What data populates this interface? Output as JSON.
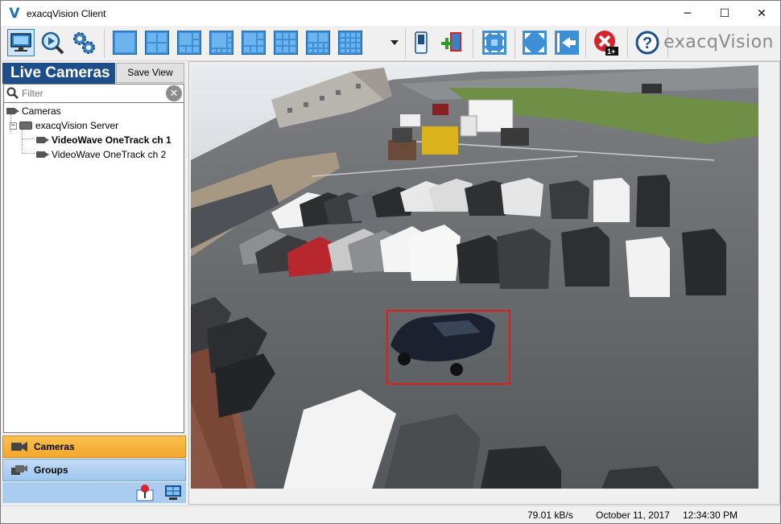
{
  "window": {
    "title": "exacqVision Client",
    "app_logo": "V",
    "controls": {
      "minimize": "─",
      "maximize": "☐",
      "close": "✕"
    }
  },
  "toolbar": {
    "brand": "exacqVision",
    "buttons": [
      "live-view-icon",
      "search-playback-icon",
      "config-gears-icon",
      "layout-1x1-icon",
      "layout-2x2-icon",
      "layout-1plus5-icon",
      "layout-1plus7-icon",
      "layout-3x3-icon",
      "layout-4x3-icon",
      "layout-4x4-icon",
      "layout-5x4-icon",
      "layout-dropdown-icon",
      "switch-icon",
      "add-view-icon",
      "fullscreen-grid-icon",
      "expand-icon",
      "sidebar-toggle-icon",
      "alarm-clear-icon",
      "help-icon"
    ],
    "alarm_badge": "1+",
    "help_glyph": "?"
  },
  "left_panel": {
    "header": "Live Cameras",
    "save_view_label": "Save View",
    "filter_placeholder": "Filter",
    "clear_glyph": "✕",
    "tree": {
      "root": "Cameras",
      "server": "exacqVision Server",
      "server_expander": "−",
      "cameras": [
        "VideoWave OneTrack ch 1",
        "VideoWave OneTrack ch 2"
      ]
    },
    "nav": {
      "cameras": "Cameras",
      "groups": "Groups"
    }
  },
  "status": {
    "throughput": "79.01 kB/s",
    "date": "October 11, 2017",
    "time": "12:34:30 PM"
  },
  "colors": {
    "live_header_bg": "#1d4e89",
    "nav_active": "#f3a72a",
    "nav_inactive": "#9ec6ee",
    "detection_box": "#e21b1b"
  }
}
